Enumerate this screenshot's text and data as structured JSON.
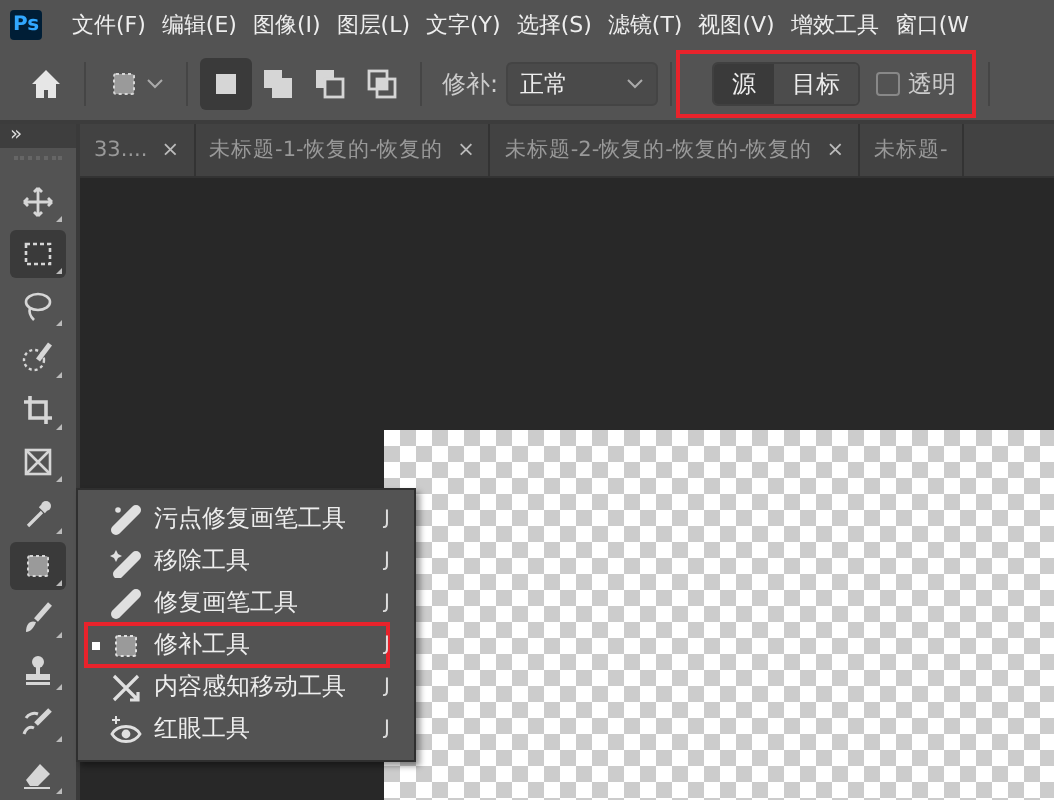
{
  "menu_bar": {
    "logo": "Ps",
    "items": [
      "文件(F)",
      "编辑(E)",
      "图像(I)",
      "图层(L)",
      "文字(Y)",
      "选择(S)",
      "滤镜(T)",
      "视图(V)",
      "增效工具",
      "窗口(W"
    ]
  },
  "options_bar": {
    "selection_modes": [
      {
        "selected": true
      },
      {
        "selected": false
      },
      {
        "selected": false
      },
      {
        "selected": false
      }
    ],
    "patch_label": "修补:",
    "patch_mode": "正常",
    "patch_source": [
      {
        "label": "源",
        "selected": true
      },
      {
        "label": "目标",
        "selected": false
      }
    ],
    "transparent": {
      "label": "透明",
      "checked": false
    }
  },
  "panel_toggle": "»",
  "tabs": [
    {
      "title": "33....",
      "close": "×"
    },
    {
      "title": "未标题-1-恢复的-恢复的",
      "close": "×"
    },
    {
      "title": "未标题-2-恢复的-恢复的-恢复的",
      "close": "×"
    },
    {
      "title": "未标题-"
    }
  ],
  "tools": [
    {
      "selected": false
    },
    {
      "selected": true
    },
    {
      "selected": false
    },
    {
      "selected": false
    },
    {
      "selected": false
    },
    {
      "selected": false
    },
    {
      "selected": false
    },
    {
      "selected": true
    },
    {
      "selected": false
    },
    {
      "selected": false
    },
    {
      "selected": false
    },
    {
      "selected": false
    }
  ],
  "flyout": [
    {
      "label": "污点修复画笔工具",
      "shortcut": "J",
      "selected": false
    },
    {
      "label": "移除工具",
      "shortcut": "J",
      "selected": false
    },
    {
      "label": "修复画笔工具",
      "shortcut": "J",
      "selected": false
    },
    {
      "label": "修补工具",
      "shortcut": "J",
      "selected": true,
      "highlighted": true
    },
    {
      "label": "内容感知移动工具",
      "shortcut": "J",
      "selected": false
    },
    {
      "label": "红眼工具",
      "shortcut": "J",
      "selected": false
    }
  ]
}
